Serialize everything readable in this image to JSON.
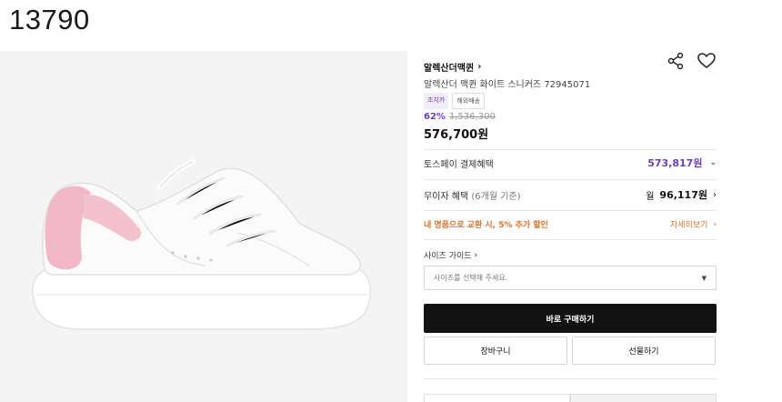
{
  "corner_id": "13790",
  "product": {
    "brand": "알렉산더맥퀸",
    "name": "알렉산더 맥퀸 화이트 스니커즈 72945071",
    "badges": [
      "조지카",
      "해외배송"
    ],
    "discount": "62%",
    "original_price": "1,536,300",
    "price": "576,700원"
  },
  "benefits": {
    "pay_label": "토스페이 결제혜택",
    "pay_amount": "573,817원",
    "installment_label": "무이자 혜택",
    "installment_sub": "(6개월 기준)",
    "installment_prefix": "월",
    "installment_amount": "96,117원",
    "exchange_text": "내 명품으로 교환 시, 5% 추가 할인",
    "exchange_link": "자세히보기"
  },
  "size": {
    "guide_label": "사이즈 가이드",
    "placeholder": "사이즈를 선택해 주세요."
  },
  "actions": {
    "buy_label": "바로 구매하기",
    "cart_label": "장바구니",
    "gift_label": "선물하기"
  },
  "icons": {
    "share": "share-icon",
    "wishlist": "heart-icon",
    "chevron": "chevron-right-icon",
    "dropdown": "caret-down-icon"
  },
  "colors": {
    "accent_purple": "#6a3fbf",
    "accent_orange": "#d9752c",
    "buy_button": "#121212",
    "sneaker_pink": "#f2b8c8"
  }
}
